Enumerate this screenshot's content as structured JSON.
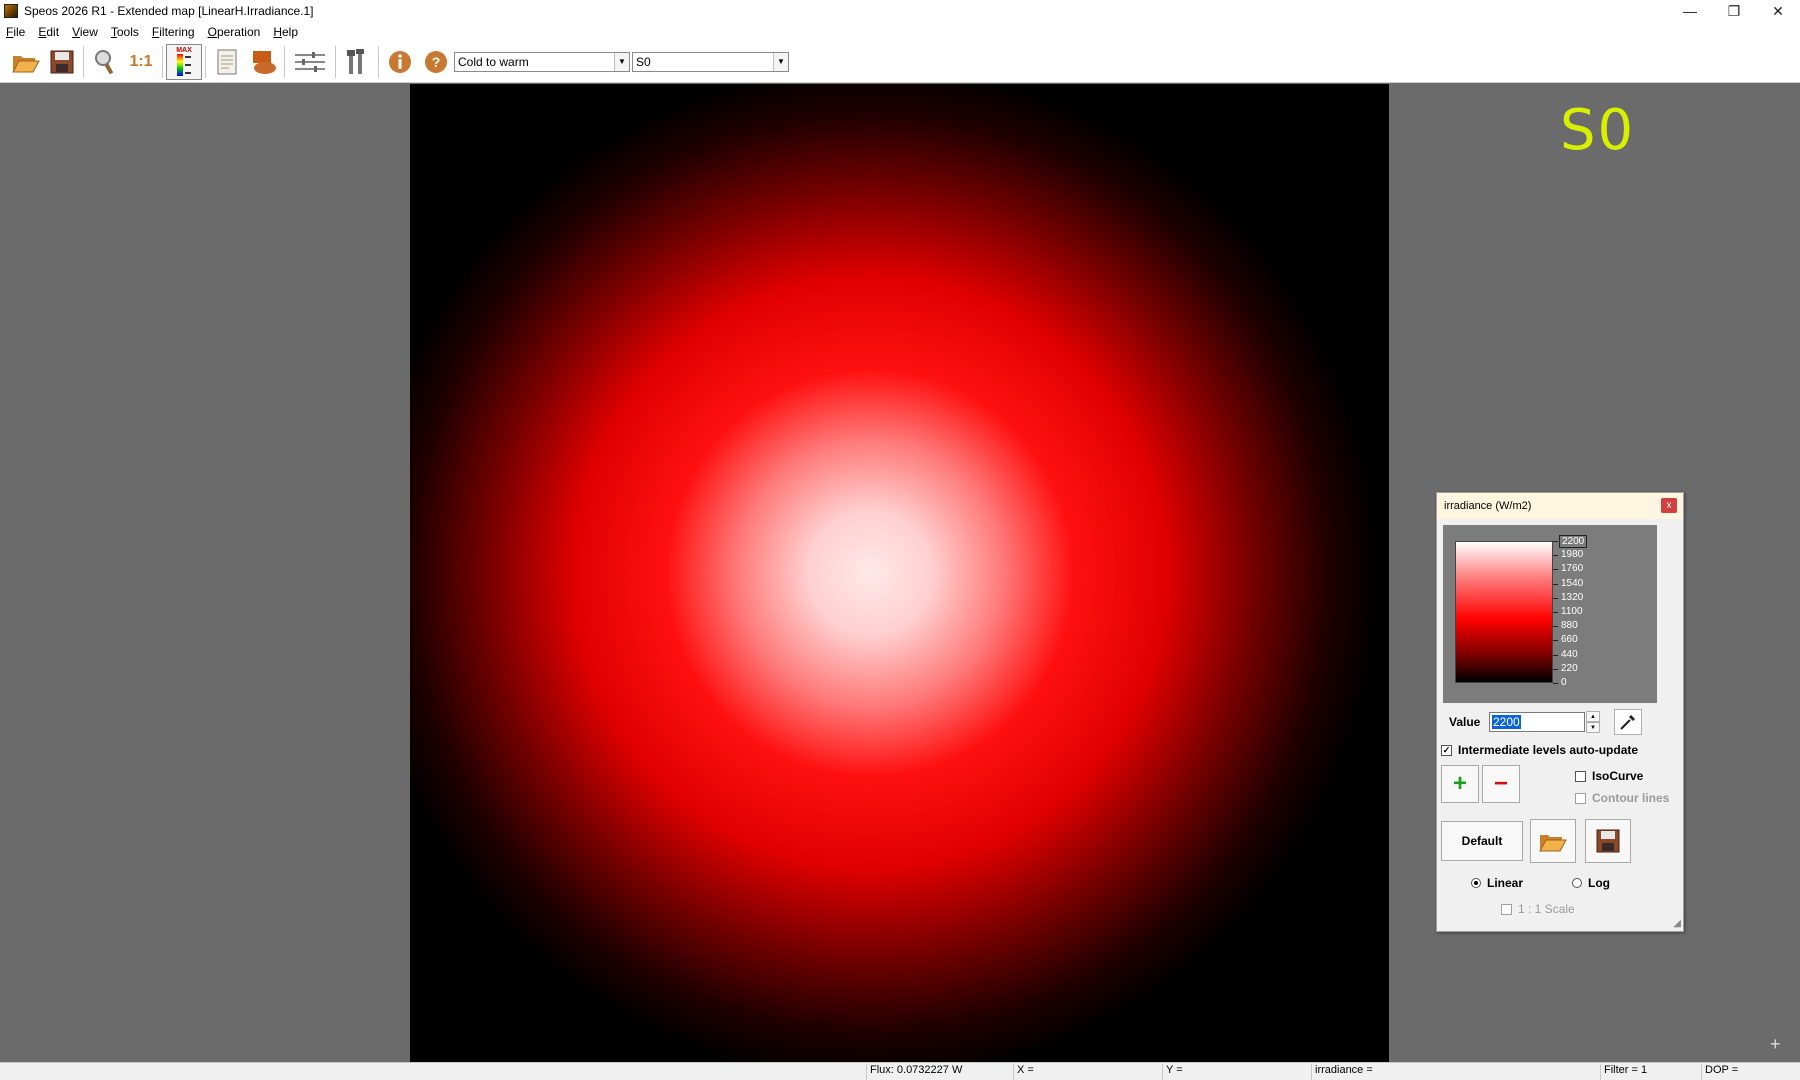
{
  "window": {
    "title": "Speos 2026 R1 - Extended map [LinearH.Irradiance.1]",
    "minimize": "—",
    "restore": "❐",
    "close": "✕"
  },
  "menu": [
    "File",
    "Edit",
    "View",
    "Tools",
    "Filtering",
    "Operation",
    "Help"
  ],
  "toolbar": {
    "zoom_ratio_label": "1:1",
    "colormap_icon_label": "MAX",
    "palette_selected": "Cold to warm",
    "sensor_selected": "S0"
  },
  "map": {
    "sensor_name": "S0"
  },
  "legend": {
    "title": "irradiance (W/m2)",
    "close_label": "x",
    "ticks": [
      "2200",
      "1980",
      "1760",
      "1540",
      "1320",
      "1100",
      "880",
      "660",
      "440",
      "220",
      "0"
    ],
    "value_label": "Value",
    "value": "2200",
    "auto_update_label": "Intermediate levels auto-update",
    "auto_update_checked": true,
    "isocurve_label": "IsoCurve",
    "contour_label": "Contour lines",
    "add_label": "+",
    "remove_label": "−",
    "default_label": "Default",
    "linear_label": "Linear",
    "log_label": "Log",
    "scale_label": "1 : 1 Scale",
    "scale_mode": "Linear"
  },
  "status": {
    "flux": "Flux: 0.0732227 W",
    "x": "X =",
    "y": "Y =",
    "irradiance": "irradiance =",
    "filter": "Filter = 1",
    "dop": "DOP ="
  },
  "colors": {
    "sensor_label": "#d8f000",
    "map_peak": "#ffffff",
    "map_mid": "#ff0000",
    "map_bg": "#000000"
  }
}
